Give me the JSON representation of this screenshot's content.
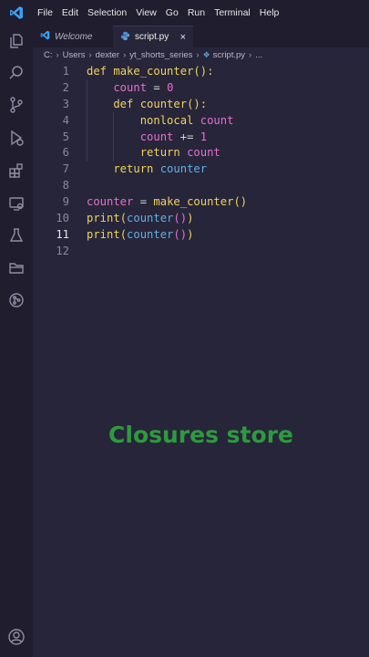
{
  "menu": [
    "File",
    "Edit",
    "Selection",
    "View",
    "Go",
    "Run",
    "Terminal",
    "Help"
  ],
  "tabs": [
    {
      "label": "Welcome",
      "active": false
    },
    {
      "label": "script.py",
      "active": true,
      "close": "×"
    }
  ],
  "breadcrumb": [
    "C:",
    "Users",
    "dexter",
    "yt_shorts_series",
    "script.py",
    "..."
  ],
  "code_lines": [
    {
      "n": "1",
      "tokens": [
        [
          "def ",
          "kw"
        ],
        [
          "make_counter",
          "fn"
        ],
        [
          "():",
          "br"
        ]
      ]
    },
    {
      "n": "2",
      "tokens": [
        [
          "    count",
          "var"
        ],
        [
          " = ",
          "op"
        ],
        [
          "0",
          "num"
        ]
      ]
    },
    {
      "n": "3",
      "tokens": [
        [
          "    def ",
          "kw"
        ],
        [
          "counter",
          "fn"
        ],
        [
          "():",
          "br"
        ]
      ]
    },
    {
      "n": "4",
      "tokens": [
        [
          "        nonlocal ",
          "kw"
        ],
        [
          "count",
          "nl"
        ]
      ]
    },
    {
      "n": "5",
      "tokens": [
        [
          "        count",
          "var"
        ],
        [
          " += ",
          "op"
        ],
        [
          "1",
          "num"
        ]
      ]
    },
    {
      "n": "6",
      "tokens": [
        [
          "        return ",
          "kw"
        ],
        [
          "count",
          "var"
        ]
      ]
    },
    {
      "n": "7",
      "tokens": [
        [
          "    return ",
          "kw"
        ],
        [
          "counter",
          "ctr"
        ]
      ]
    },
    {
      "n": "8",
      "tokens": []
    },
    {
      "n": "9",
      "tokens": [
        [
          "counter",
          "var"
        ],
        [
          " = ",
          "op"
        ],
        [
          "make_counter",
          "fn"
        ],
        [
          "()",
          "br"
        ]
      ]
    },
    {
      "n": "10",
      "tokens": [
        [
          "print",
          "call"
        ],
        [
          "(",
          "br"
        ],
        [
          "counter",
          "ctr"
        ],
        [
          "()",
          "br2"
        ],
        [
          ")",
          "br"
        ]
      ]
    },
    {
      "n": "11",
      "tokens": [
        [
          "print",
          "call"
        ],
        [
          "(",
          "br"
        ],
        [
          "counter",
          "ctr"
        ],
        [
          "()",
          "br2"
        ],
        [
          ")",
          "br"
        ]
      ]
    },
    {
      "n": "12",
      "tokens": []
    }
  ],
  "current_line": "11",
  "caption": "Closures store",
  "colors": {
    "background": "#27253a",
    "sidebar": "#1f1d2e",
    "caption": "#2e9a3e",
    "keyword": "#f0d35a",
    "variable": "#e86fcf",
    "function_ref": "#5fb0e8"
  },
  "activity_icons": [
    "explorer-icon",
    "search-icon",
    "source-control-icon",
    "run-debug-icon",
    "extensions-icon",
    "remote-explorer-icon",
    "testing-icon",
    "folder-icon",
    "git-graph-icon",
    "account-icon"
  ]
}
